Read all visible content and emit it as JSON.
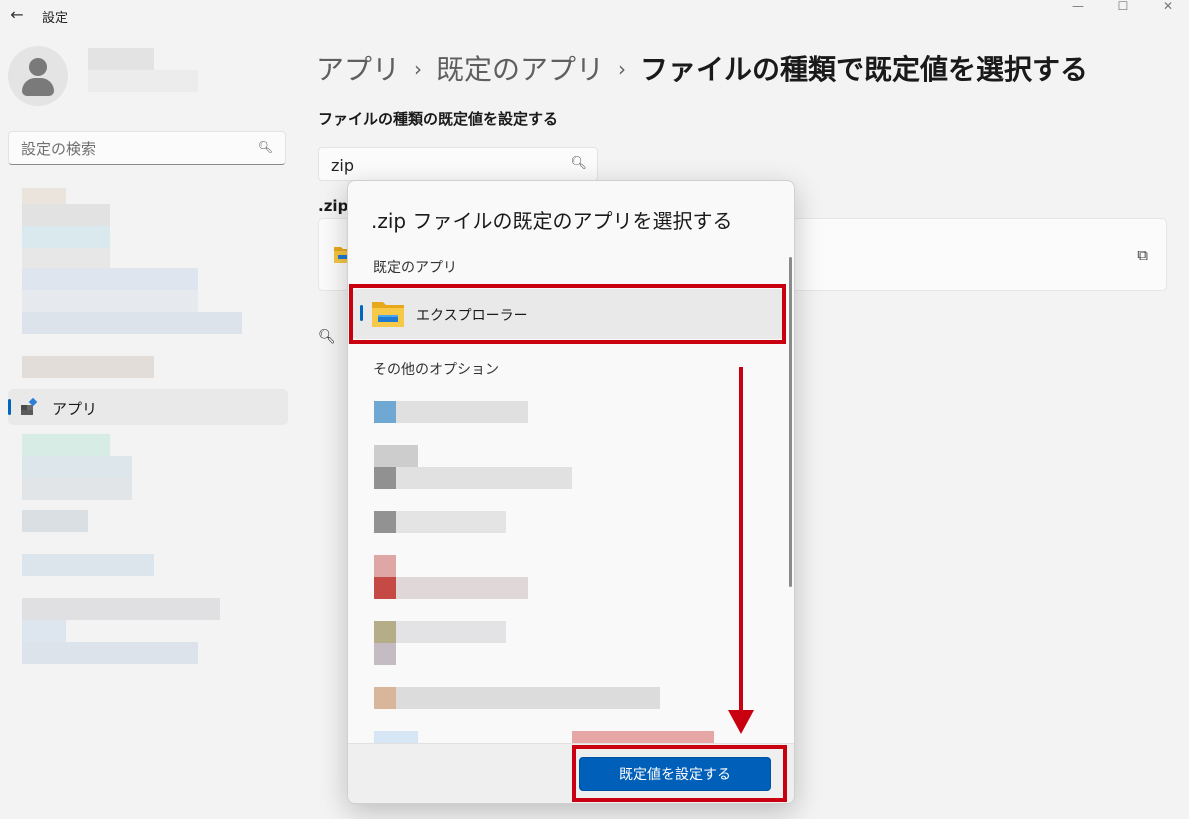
{
  "window": {
    "title": "設定",
    "back_icon": "arrow-left-icon",
    "controls": {
      "minimize": "—",
      "maximize": "☐",
      "close": "✕"
    }
  },
  "sidebar": {
    "search_placeholder": "設定の検索",
    "selected_item": "アプリ"
  },
  "breadcrumb": {
    "items": [
      "アプリ",
      "既定のアプリ"
    ],
    "separator": "›",
    "current": "ファイルの種類で既定値を選択する"
  },
  "main": {
    "section_title": "ファイルの種類の既定値を設定する",
    "search_value": "zip",
    "extension": ".zip"
  },
  "dialog": {
    "title": ".zip ファイルの既定のアプリを選択する",
    "default_section": "既定のアプリ",
    "default_app": "エクスプローラー",
    "other_section": "その他のオプション",
    "primary_button": "既定値を設定する"
  },
  "colors": {
    "accent": "#005fb8",
    "annotation": "#c8000f"
  }
}
